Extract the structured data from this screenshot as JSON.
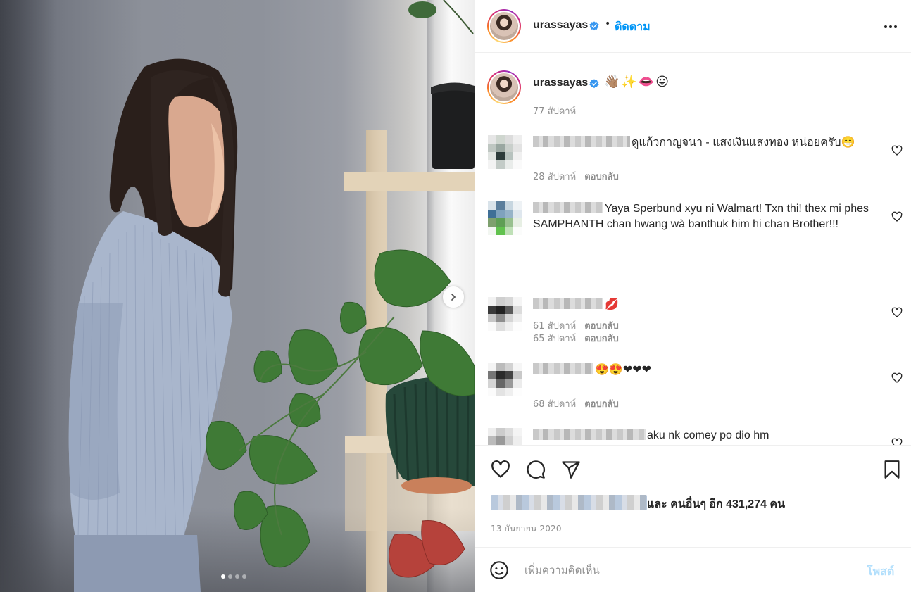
{
  "post": {
    "username": "urassayas",
    "separator": "•",
    "follow_label": "ติดตาม",
    "caption_emoji": "👋🏽✨👄😛",
    "caption_time": "77 สัปดาห์",
    "image_count": 4,
    "active_image_index": 0
  },
  "icons": {
    "verified": "verified-badge-icon",
    "more": "more-options-icon",
    "next": "chevron-right-icon",
    "like": "heart-icon",
    "comment": "comment-icon",
    "share": "paper-plane-icon",
    "save": "bookmark-icon",
    "emoji": "smiley-icon"
  },
  "comments": [
    {
      "text": "ดูแก้วกาญจนา - แสงเงินแสงทอง หน่อยครับ😁",
      "time": "28 สัปดาห์",
      "reply": "ตอบกลับ"
    },
    {
      "text": "Yaya Sperbund xyu ni Walmart! Txn thi! thex mi phes SAMPHANTH chan hwang wà banthuk him hi chan Brother!!!",
      "time": "61 สัปดาห์",
      "reply": "ตอบกลับ"
    },
    {
      "text": "💋",
      "time": "65 สัปดาห์",
      "reply": "ตอบกลับ"
    },
    {
      "text": "😍😍❤❤❤",
      "time": "68 สัปดาห์",
      "reply": "ตอบกลับ"
    },
    {
      "text": "aku nk comey po dio hm",
      "time": "",
      "reply": ""
    }
  ],
  "likes": {
    "suffix": "และ คนอื่นๆ อีก 431,274 คน"
  },
  "date": "13 กันยายน 2020",
  "composer": {
    "placeholder": "เพิ่มความคิดเห็น",
    "post_label": "โพสต์"
  },
  "colors": {
    "accent": "#0095f6",
    "post_disabled": "#b2dffc",
    "muted": "#8e8e8e",
    "text": "#262626"
  }
}
